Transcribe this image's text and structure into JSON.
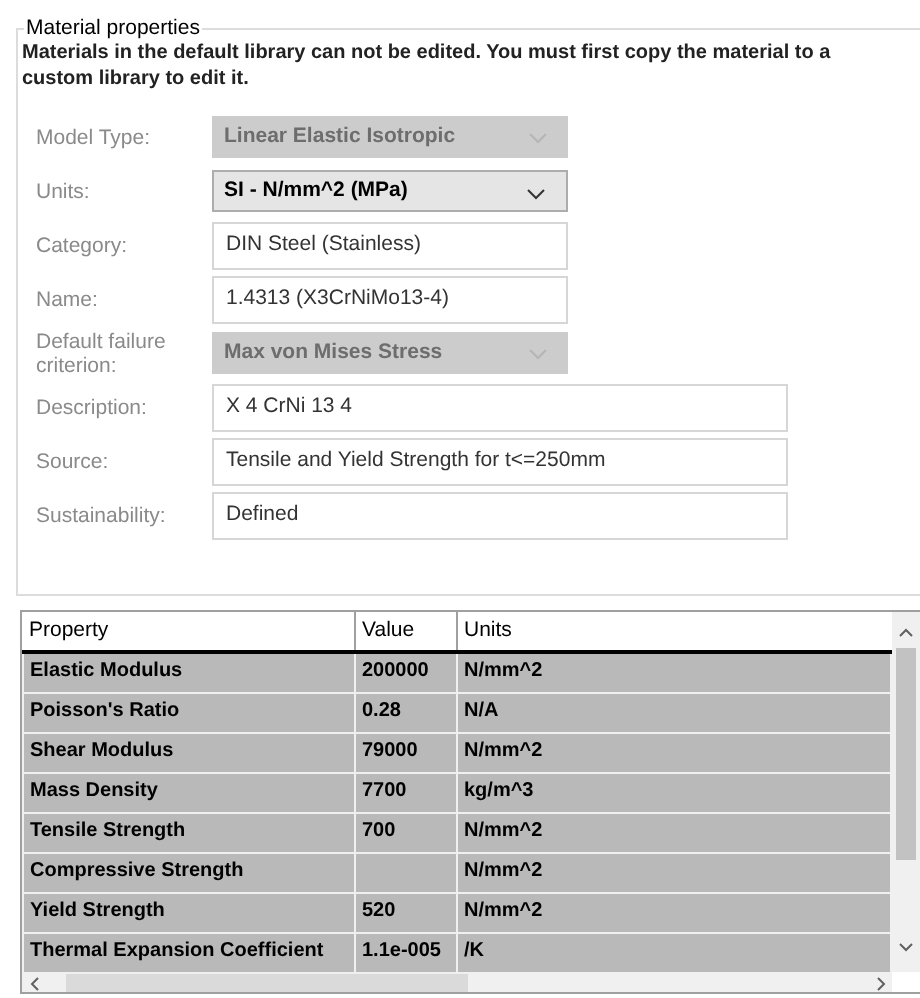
{
  "group": {
    "title": "Material properties",
    "notice": "Materials in the default library can not be edited. You must first copy the material to a custom library to edit it."
  },
  "fields": [
    {
      "label": "Model Type:",
      "kind": "dropdown",
      "value": "Linear Elastic Isotropic",
      "disabled": true
    },
    {
      "label": "Units:",
      "kind": "dropdown",
      "value": "SI - N/mm^2 (MPa)",
      "disabled": false
    },
    {
      "label": "Category:",
      "kind": "text",
      "value": "DIN Steel (Stainless)"
    },
    {
      "label": "Name:",
      "kind": "text",
      "value": "1.4313 (X3CrNiMo13-4)"
    },
    {
      "label": "Default failure criterion:",
      "kind": "dropdown",
      "value": "Max von Mises Stress",
      "disabled": true
    },
    {
      "label": "Description:",
      "kind": "wide",
      "value": "X 4 CrNi 13 4"
    },
    {
      "label": "Source:",
      "kind": "wide",
      "value": "Tensile and Yield Strength for t<=250mm"
    },
    {
      "label": "Sustainability:",
      "kind": "wide",
      "value": "Defined"
    }
  ],
  "table": {
    "columns": [
      "Property",
      "Value",
      "Units"
    ],
    "rows": [
      [
        "Elastic Modulus",
        "200000",
        "N/mm^2"
      ],
      [
        "Poisson's Ratio",
        "0.28",
        "N/A"
      ],
      [
        "Shear Modulus",
        "79000",
        "N/mm^2"
      ],
      [
        "Mass Density",
        "7700",
        "kg/m^3"
      ],
      [
        "Tensile Strength",
        "700",
        "N/mm^2"
      ],
      [
        "Compressive Strength",
        "",
        "N/mm^2"
      ],
      [
        "Yield Strength",
        "520",
        "N/mm^2"
      ],
      [
        "Thermal Expansion Coefficient",
        "1.1e-005",
        "/K"
      ]
    ]
  }
}
